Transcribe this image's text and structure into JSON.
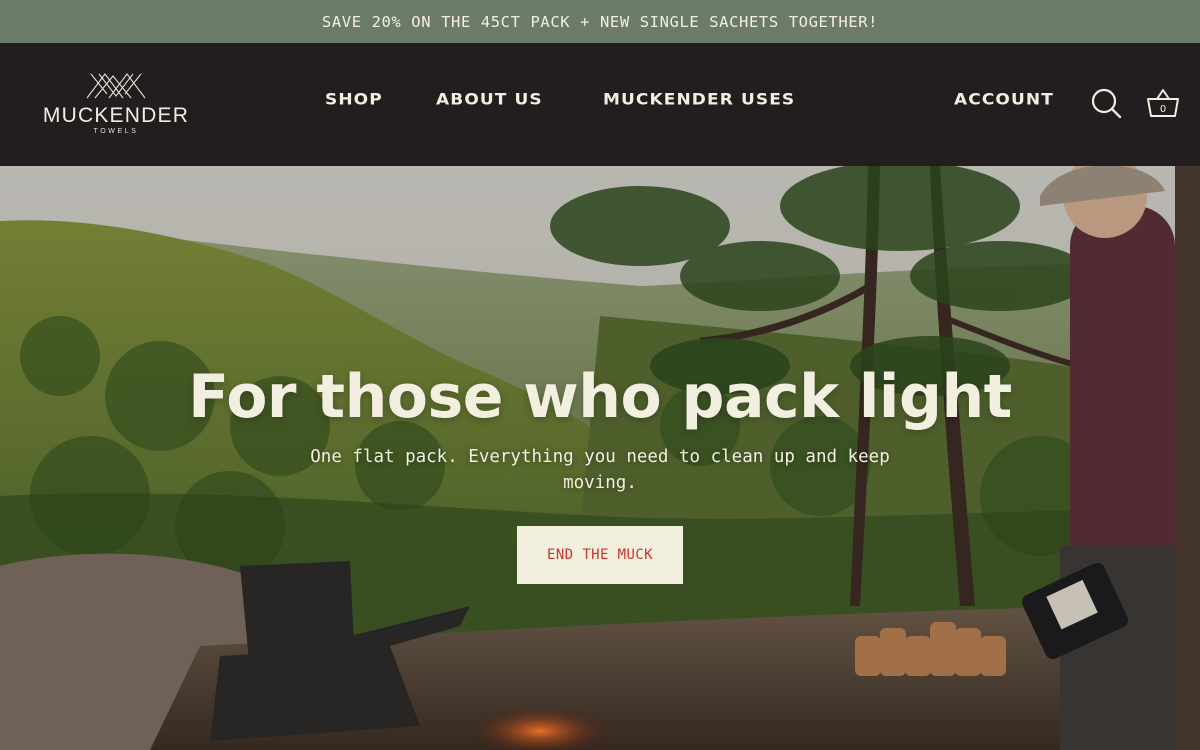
{
  "announcement": "SAVE 20% ON THE 45CT PACK + NEW SINGLE SACHETS TOGETHER!",
  "brand": {
    "name": "MUCKENDER",
    "tagline": "TOWELS"
  },
  "nav": {
    "items": [
      "SHOP",
      "ABOUT US",
      "MUCKENDER USES"
    ]
  },
  "header_actions": {
    "account_label": "ACCOUNT",
    "search_icon": "search-icon",
    "cart_icon": "basket-icon",
    "cart_count": "0"
  },
  "hero": {
    "title": "For those who pack light",
    "subtitle": "One flat pack. Everything you need to clean up and keep moving.",
    "cta_label": "END THE MUCK",
    "image": "hero-photo: forested mountain overlook with pine trees, camp chair, firewood and a hiker"
  },
  "colors": {
    "announcement_bg": "#6c7b68",
    "header_bg": "#221d1e",
    "cream": "#f2eee0",
    "cta_text": "#c7352f"
  }
}
